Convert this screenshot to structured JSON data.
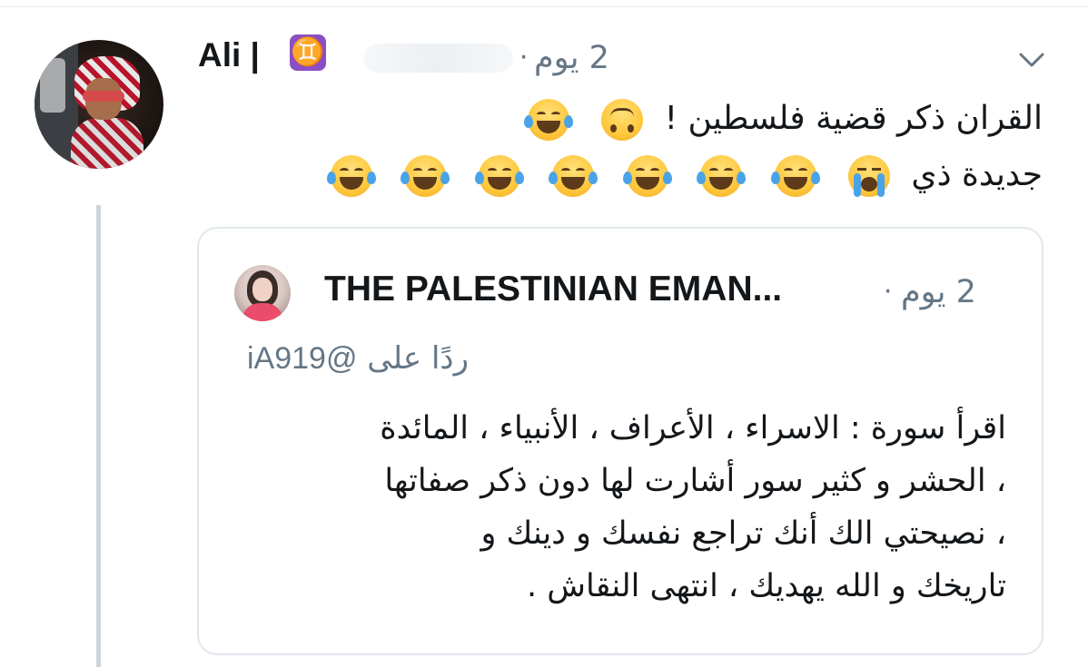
{
  "tweet": {
    "author_name": "Ali |",
    "author_badge": "♊",
    "time_label": "2 يوم",
    "separator": "·",
    "text_line1": "القران ذكر قضية فلسطين !",
    "text_line2": "جديدة ذي",
    "line1_emojis": [
      "upside-down-face-emoji",
      "tears-of-joy-emoji"
    ],
    "line2_emojis": [
      "loudly-crying-emoji",
      "tears-of-joy-emoji",
      "tears-of-joy-emoji",
      "tears-of-joy-emoji",
      "tears-of-joy-emoji",
      "tears-of-joy-emoji",
      "tears-of-joy-emoji",
      "tears-of-joy-emoji"
    ]
  },
  "quoted_tweet": {
    "author_name": "THE PALESTINIAN EMAN...",
    "time_label": "2 يوم",
    "separator": "·",
    "reply_prefix": "ردًا على",
    "reply_handle": "@iA919",
    "text_lines": [
      "اقرأ سورة : الاسراء ، الأعراف ، الأنبياء ، المائدة",
      "، الحشر و كثير سور أشارت لها دون ذكر صفاتها",
      "، نصيحتي الك أنك تراجع نفسك و دينك و",
      "تاريخك و الله يهديك ، انتهى النقاش ."
    ]
  },
  "colors": {
    "text": "#14171a",
    "muted": "#657786",
    "border": "#e1e8ed",
    "thread_line": "#ccd6dd",
    "badge": "#8b4fc4"
  }
}
